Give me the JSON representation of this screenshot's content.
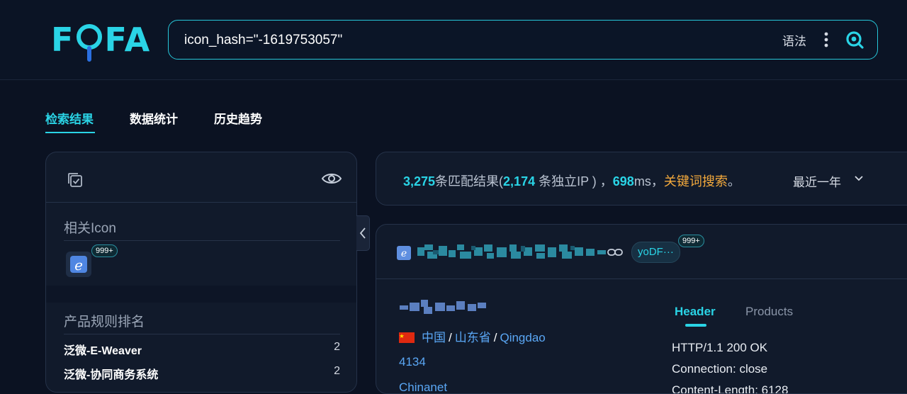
{
  "logo": {
    "text_left": "F",
    "text_right": "FA",
    "accent": "#2ad4e6"
  },
  "search": {
    "query": "icon_hash=\"-1619753057\"",
    "syntax_label": "语法"
  },
  "tabs": [
    {
      "label": "检索结果",
      "active": true
    },
    {
      "label": "数据统计",
      "active": false
    },
    {
      "label": "历史趋势",
      "active": false
    }
  ],
  "sidebar": {
    "related_icon_title": "相关Icon",
    "icon_badge": "999+",
    "product_rank_title": "产品规则排名",
    "products": [
      {
        "name": "泛微-E-Weaver",
        "count": "2"
      },
      {
        "name": "泛微-协同商务系统",
        "count": "2"
      }
    ]
  },
  "stats": {
    "match_count": "3,275",
    "match_label": "条匹配结果(",
    "ip_count": "2,174",
    "ip_label": " 条独立IP ) ，",
    "time": "698",
    "time_unit": "ms，",
    "keyword_search": "关键词搜索",
    "period_end": "。",
    "range": "最近一年"
  },
  "result": {
    "tag": "yoDF···",
    "tag_badge": "999+",
    "country": "中国",
    "province": "山东省",
    "city": "Qingdao",
    "port": "4134",
    "asn_org": "Chinanet",
    "tabs": [
      {
        "label": "Header",
        "active": true
      },
      {
        "label": "Products",
        "active": false
      }
    ],
    "header_lines": [
      "HTTP/1.1 200 OK",
      "Connection: close",
      "Content-Length: 6128"
    ]
  },
  "colors": {
    "accent": "#2ad4e6",
    "keyword": "#f3a93c",
    "link": "#5aa7f5",
    "background": "#0b1222"
  }
}
